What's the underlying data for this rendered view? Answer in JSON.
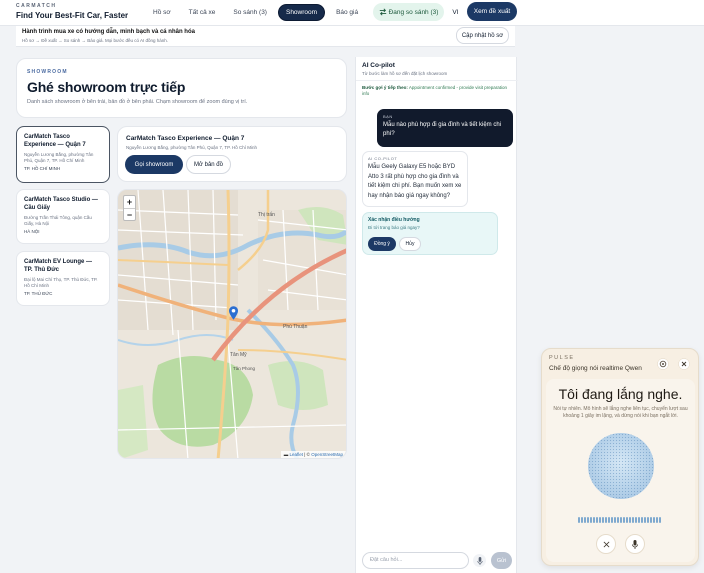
{
  "header": {
    "brand_kicker": "CARMATCH",
    "brand_title": "Find Your Best-Fit Car, Faster",
    "nav": [
      {
        "label": "Hồ sơ",
        "active": false
      },
      {
        "label": "Tất cả xe",
        "active": false
      },
      {
        "label": "So sánh (3)",
        "active": false
      },
      {
        "label": "Showroom",
        "active": true
      },
      {
        "label": "Báo giá",
        "active": false
      }
    ],
    "compare_button": "Đang so sánh (3)",
    "language": "VI",
    "proposal_button": "Xem đề xuất"
  },
  "journey": {
    "title": "Hành trình mua xe có hướng dẫn, minh bạch và cá nhân hóa",
    "steps": "Hồ sơ → Đề xuất → So sánh → Báo giá. Mọi bước đều có AI đồng hành.",
    "update_button": "Cập nhật hồ sơ"
  },
  "showroom_page": {
    "kicker": "SHOWROOM",
    "title": "Ghé showroom trực tiếp",
    "description": "Danh sách showroom ở bên trái, bản đồ ở bên phải. Chạm showroom để zoom đúng vị trí."
  },
  "showrooms": [
    {
      "name": "CarMatch Tasco Experience — Quận 7",
      "address": "Nguyễn Lương Bằng, phường Tân Phú, Quận 7, TP. Hồ Chí Minh",
      "city": "TP. HỒ CHÍ MINH",
      "selected": true
    },
    {
      "name": "CarMatch Tasco Studio — Cầu Giấy",
      "address": "Đường Trần Thái Tông, quận Cầu Giấy, Hà Nội",
      "city": "HÀ NỘI",
      "selected": false
    },
    {
      "name": "CarMatch EV Lounge — TP. Thủ Đức",
      "address": "Đại lộ Mai Chí Thọ, TP. Thủ Đức, TP. Hồ Chí Minh",
      "city": "TP. THỦ ĐỨC",
      "selected": false
    }
  ],
  "detail": {
    "name": "CarMatch Tasco Experience — Quận 7",
    "address": "Nguyễn Lương Bằng, phường Tân Phú, Quận 7, TP. Hồ Chí Minh",
    "call_button": "Gọi showroom",
    "map_button": "Mở bản đồ"
  },
  "map": {
    "zoom_in": "+",
    "zoom_out": "−",
    "attribution_leaflet": "Leaflet",
    "attribution_sep": " | © ",
    "attribution_osm": "OpenStreetMap",
    "labels": [
      "Thị trấn",
      "Phú Thuận",
      "Tân Mỹ",
      "Tân Phong"
    ]
  },
  "copilot": {
    "title": "AI Co-pilot",
    "subtitle": "Từ bước làm hồ sơ đến đặt lịch showroom",
    "hint_label": "Bước gợi ý tiếp theo:",
    "hint_text": " Appointment confirmed - provide visit preparation info",
    "user_label": "BẠN",
    "user_message": "Mẫu nào phù hợp đi gia đình và tiết kiệm chi phí?",
    "ai_label": "AI CO-PILOT",
    "ai_message": "Mẫu Geely Galaxy E5 hoặc BYD Atto 3 rất phù hợp cho gia đình và tiết kiệm chi phí. Bạn muốn xem xe hay nhận báo giá ngay không?",
    "confirm_title": "Xác nhận điều hướng",
    "confirm_question": "Đi tới trang báo giá ngay?",
    "confirm_ok": "Đồng ý",
    "confirm_cancel": "Hủy",
    "input_placeholder": "Đặt câu hỏi...",
    "send_button": "Gửi"
  },
  "pulse": {
    "kicker": "PULSE",
    "subtitle": "Chế độ giọng nói realtime Qwen",
    "title": "Tôi đang lắng nghe.",
    "description": "Nói tự nhiên. Mô hình sẽ lắng nghe liên tục, chuyển lượt sau khoảng 1 giây im lặng, và dừng nói khi bạn ngắt lời."
  },
  "colors": {
    "primary": "#1c3965",
    "nav_active": "#162a4a",
    "compare_bg": "#e3f4ec",
    "pulse_bg": "#f7efe3",
    "pin": "#2c6fd1"
  }
}
